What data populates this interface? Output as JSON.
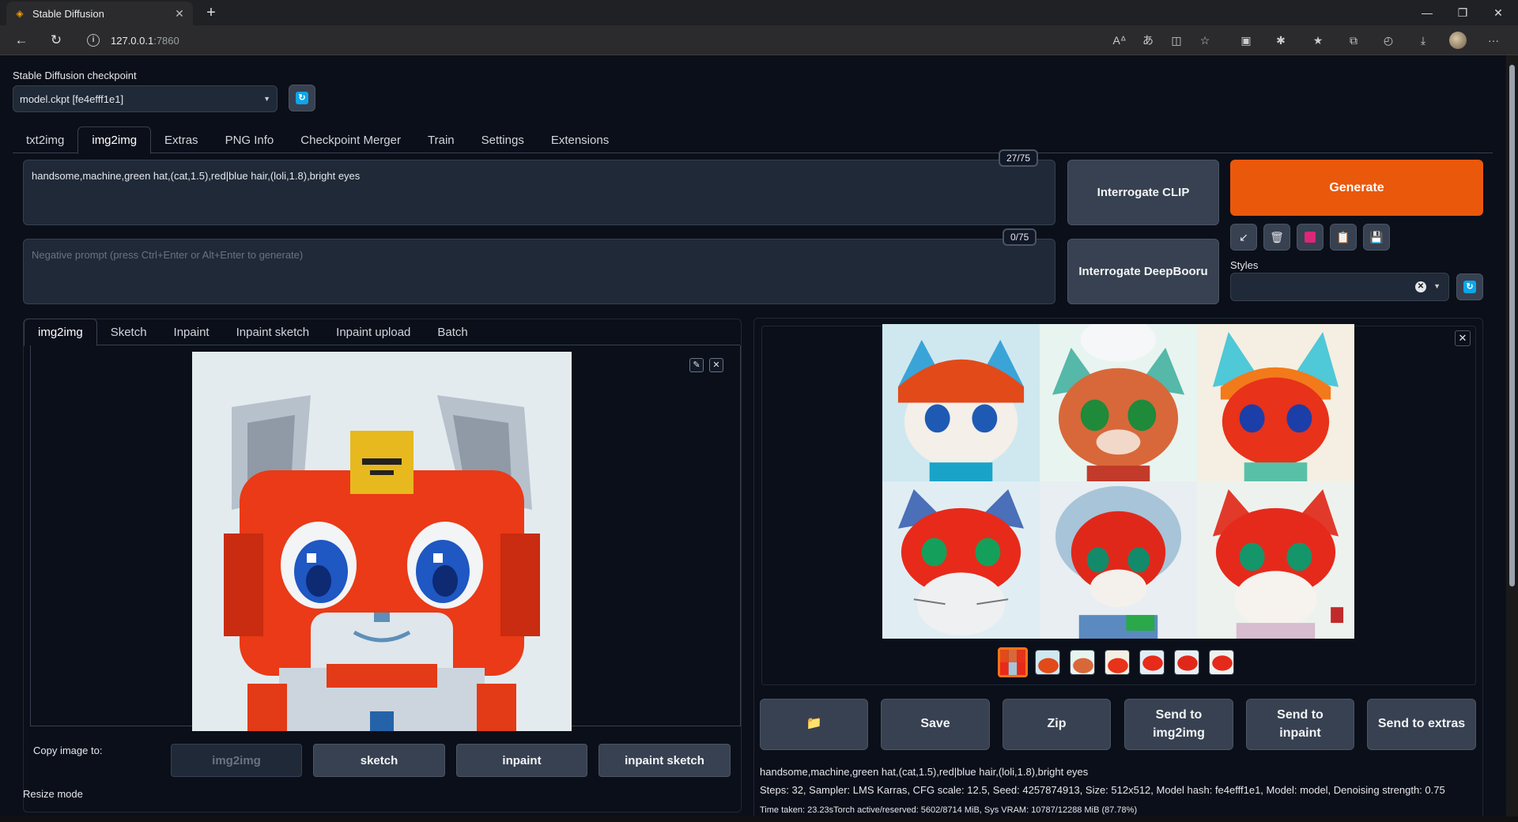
{
  "browser": {
    "tab_title": "Stable Diffusion",
    "url_host": "127.0.0.1",
    "url_port": ":7860"
  },
  "checkpoint": {
    "label": "Stable Diffusion checkpoint",
    "value": "model.ckpt [fe4efff1e1]"
  },
  "main_tabs": [
    "txt2img",
    "img2img",
    "Extras",
    "PNG Info",
    "Checkpoint Merger",
    "Train",
    "Settings",
    "Extensions"
  ],
  "prompt": {
    "text": "handsome,machine,green hat,(cat,1.5),red|blue hair,(loli,1.8),bright eyes",
    "token_count": "27/75"
  },
  "negative_prompt": {
    "placeholder": "Negative prompt (press Ctrl+Enter or Alt+Enter to generate)",
    "token_count": "0/75"
  },
  "buttons": {
    "interrogate_clip": "Interrogate CLIP",
    "interrogate_deepbooru": "Interrogate DeepBooru",
    "generate": "Generate"
  },
  "styles": {
    "label": "Styles"
  },
  "sub_tabs": [
    "img2img",
    "Sketch",
    "Inpaint",
    "Inpaint sketch",
    "Inpaint upload",
    "Batch"
  ],
  "copy_image": {
    "label": "Copy image to:",
    "targets": [
      "img2img",
      "sketch",
      "inpaint",
      "inpaint sketch"
    ]
  },
  "resize_mode": {
    "label": "Resize mode"
  },
  "output_buttons": {
    "folder_icon": "📁",
    "save": "Save",
    "zip": "Zip",
    "send_img2img": "Send to img2img",
    "send_inpaint": "Send to inpaint",
    "send_extras": "Send to extras"
  },
  "generation_info": {
    "prompt": "handsome,machine,green hat,(cat,1.5),red|blue hair,(loli,1.8),bright eyes",
    "params": "Steps: 32, Sampler: LMS Karras, CFG scale: 12.5, Seed: 4257874913, Size: 512x512, Model hash: fe4efff1e1, Model: model, Denoising strength: 0.75",
    "time": "Time taken: 23.23sTorch active/reserved: 5602/8714 MiB, Sys VRAM: 10787/12288 MiB (87.78%)"
  },
  "colors": {
    "accent": "#ea580c",
    "background": "#0b0f19",
    "panel": "#1f2937"
  }
}
